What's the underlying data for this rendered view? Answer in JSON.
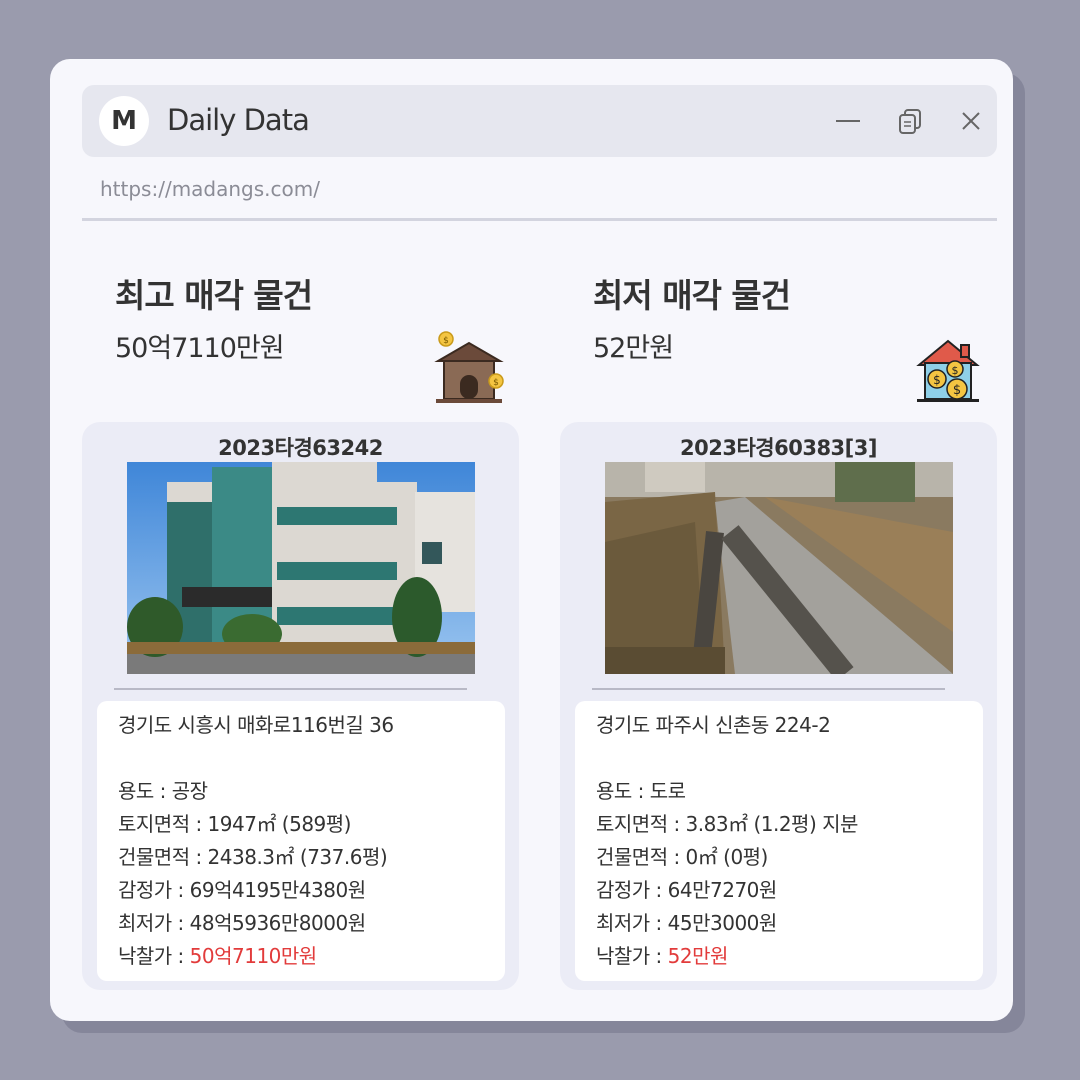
{
  "window": {
    "avatar_letter": "M",
    "title": "Daily Data",
    "url": "https://madangs.com/"
  },
  "columns": [
    {
      "heading": "최고 매각 물건",
      "price": "50억7110만원",
      "icon": "house-money-icon",
      "case_no": "2023타경63242",
      "address": "경기도 시흥시 매화로116번길 36",
      "usage": "용도 : 공장",
      "land_area": "토지면적 : 1947㎡ (589평)",
      "building_area": "건물면적 : 2438.3㎡ (737.6평)",
      "appraisal": "감정가 : 69억4195만4380원",
      "minimum": "최저가 : 48억5936만8000원",
      "winning_label": "낙찰가 : ",
      "winning_value": "50억7110만원"
    },
    {
      "heading": "최저 매각 물건",
      "price": "52만원",
      "icon": "house-coins-icon",
      "case_no": "2023타경60383[3]",
      "address": "경기도 파주시 신촌동 224-2",
      "usage": "용도 : 도로",
      "land_area": "토지면적 : 3.83㎡ (1.2평) 지분",
      "building_area": "건물면적 : 0㎡ (0평)",
      "appraisal": "감정가 : 64만7270원",
      "minimum": "최저가 : 45만3000원",
      "winning_label": "낙찰가 : ",
      "winning_value": "52만원"
    }
  ],
  "colors": {
    "accent_red": "#e23b3b",
    "background": "#9a9bad",
    "card": "#ebecf6"
  }
}
